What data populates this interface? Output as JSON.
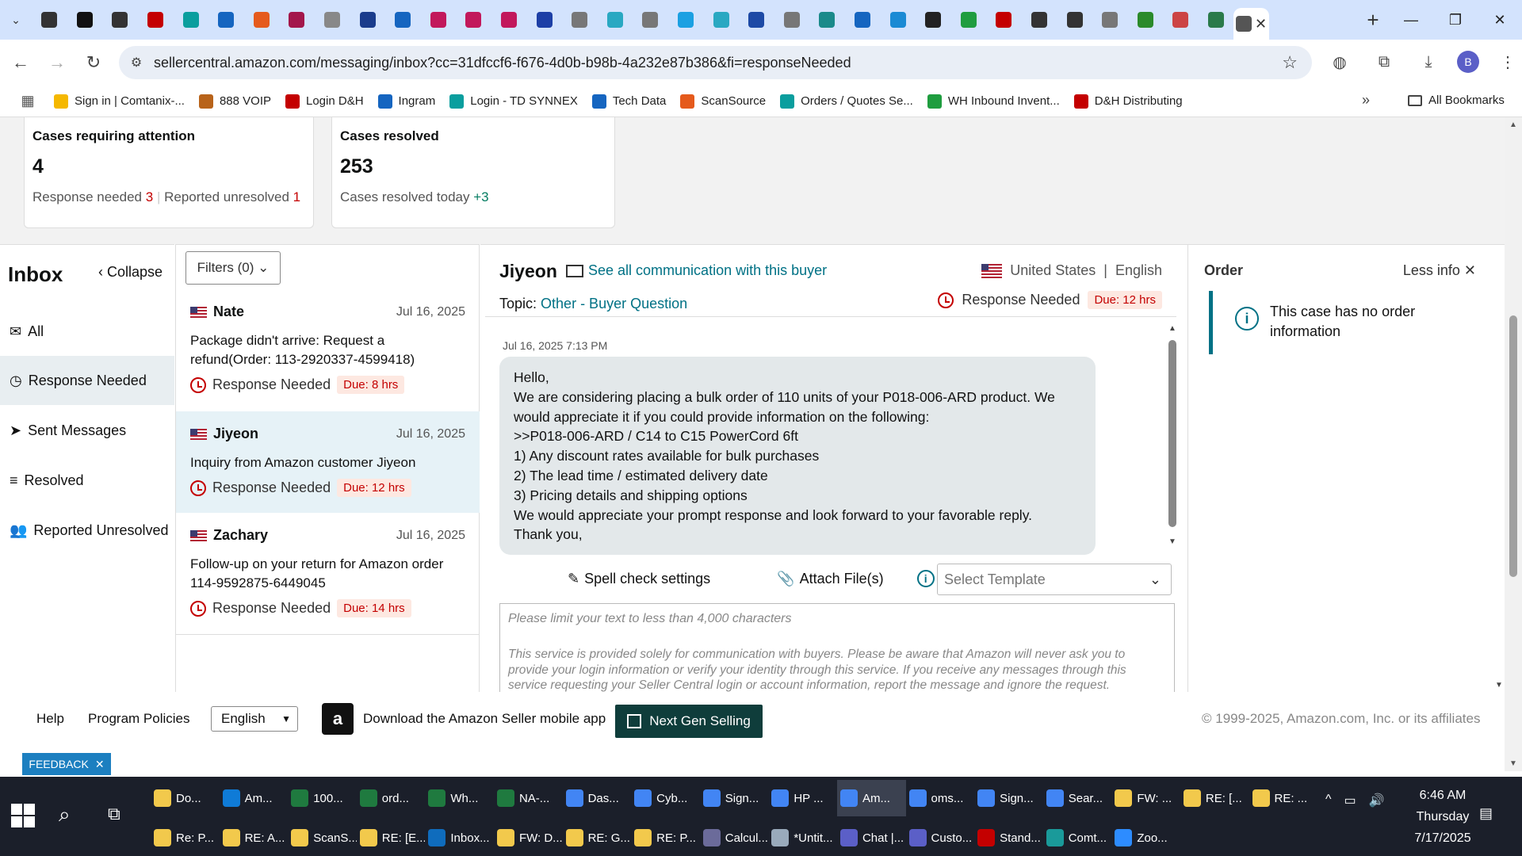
{
  "browser": {
    "tabs": [
      {
        "color": "#333"
      },
      {
        "color": "#111"
      },
      {
        "color": "#333"
      },
      {
        "color": "#c40000"
      },
      {
        "color": "#0a9e9e"
      },
      {
        "color": "#1565c0"
      },
      {
        "color": "#e55a1c"
      },
      {
        "color": "#a3174b"
      },
      {
        "color": "#888"
      },
      {
        "color": "#1a3c8c"
      },
      {
        "color": "#1565c0"
      },
      {
        "color": "#c2185b"
      },
      {
        "color": "#c2185b"
      },
      {
        "color": "#c2185b"
      },
      {
        "color": "#1d3fa6"
      },
      {
        "color": "#777"
      },
      {
        "color": "#29a8c2"
      },
      {
        "color": "#777"
      },
      {
        "color": "#1ba0e2"
      },
      {
        "color": "#29a8c2"
      },
      {
        "color": "#1d4aa6"
      },
      {
        "color": "#777"
      },
      {
        "color": "#1a8a8a"
      },
      {
        "color": "#1565c0"
      },
      {
        "color": "#1a8ad4"
      },
      {
        "color": "#222"
      },
      {
        "color": "#1f9d3f"
      },
      {
        "color": "#c40000"
      },
      {
        "color": "#333"
      },
      {
        "color": "#333"
      },
      {
        "color": "#777"
      },
      {
        "color": "#2a8a2a"
      },
      {
        "color": "#cc4444"
      },
      {
        "color": "#2a7a4a"
      },
      {
        "color": "#555"
      }
    ],
    "close_tab": "✕",
    "new_tab": "+",
    "url": "sellercentral.amazon.com/messaging/inbox?cc=31dfccf6-f676-4d0b-b98b-4a232e87b386&fi=responseNeeded",
    "profile_initial": "B",
    "bookmarks": [
      {
        "label": "Sign in | Comtanix-...",
        "color": "#f5b800"
      },
      {
        "label": "888 VOIP",
        "color": "#b8631a"
      },
      {
        "label": "Login D&H",
        "color": "#c40000"
      },
      {
        "label": "Ingram",
        "color": "#1565c0"
      },
      {
        "label": "Login - TD SYNNEX",
        "color": "#0a9e9e"
      },
      {
        "label": "Tech Data",
        "color": "#1565c0"
      },
      {
        "label": "ScanSource",
        "color": "#e55a1c"
      },
      {
        "label": "Orders / Quotes Se...",
        "color": "#0a9e9e"
      },
      {
        "label": "WH Inbound Invent...",
        "color": "#1f9d3f"
      },
      {
        "label": "D&H Distributing",
        "color": "#c40000"
      }
    ],
    "bookmarks_more": "»",
    "all_bookmarks": "All Bookmarks"
  },
  "stats": {
    "attention": {
      "title": "Cases requiring attention",
      "count": "4",
      "label1": "Response needed",
      "val1": "3",
      "label2": "Reported unresolved",
      "val2": "1"
    },
    "resolved": {
      "title": "Cases resolved",
      "count": "253",
      "label1": "Cases resolved today",
      "val1": "+3"
    }
  },
  "nav": {
    "title": "Inbox",
    "collapse": "Collapse",
    "items": [
      {
        "label": "All",
        "icon": "✉"
      },
      {
        "label": "Response Needed",
        "icon": "◷"
      },
      {
        "label": "Sent Messages",
        "icon": "➤"
      },
      {
        "label": "Resolved",
        "icon": "≡"
      },
      {
        "label": "Reported Unresolved",
        "icon": "👥"
      }
    ]
  },
  "list": {
    "filters": "Filters (0)",
    "conversations": [
      {
        "name": "Nate",
        "date": "Jul 16, 2025",
        "subject": "Package didn't arrive: Request a refund(Order: 113-2920337-4599418)",
        "status": "Response Needed",
        "due": "Due: 8 hrs"
      },
      {
        "name": "Jiyeon",
        "date": "Jul 16, 2025",
        "subject": "Inquiry from Amazon customer Jiyeon",
        "status": "Response Needed",
        "due": "Due: 12 hrs"
      },
      {
        "name": "Zachary",
        "date": "Jul 16, 2025",
        "subject": "Follow-up on your return for Amazon order 114-9592875-6449045",
        "status": "Response Needed",
        "due": "Due: 14 hrs"
      }
    ]
  },
  "thread": {
    "buyer": "Jiyeon",
    "see_all": "See all communication with this buyer",
    "country": "United States",
    "language": "English",
    "topic_label": "Topic:",
    "topic_value": "Other - Buyer Question",
    "status": "Response Needed",
    "due": "Due: 12 hrs",
    "message_date": "Jul 16, 2025 7:13 PM",
    "message_lines": [
      "Hello,",
      "We are considering placing a bulk order of 110 units of your P018-006-ARD product. We would appreciate it if you could provide information on the following:",
      ">>P018-006-ARD  / C14 to C15 PowerCord 6ft",
      "1) Any discount rates available for bulk purchases",
      "2) The lead time / estimated delivery date",
      "3) Pricing details and shipping options",
      "We would appreciate your prompt response and look forward to your favorable reply.",
      "Thank you,"
    ],
    "spell_check": "Spell check settings",
    "attach": "Attach File(s)",
    "template_placeholder": "Select Template",
    "compose_placeholder": "Please limit your text to less than 4,000 characters",
    "disclaimer": "This service is provided solely for communication with buyers. Please be aware that Amazon will never ask you to provide your login information or verify your identity through this service. If you receive any messages through this service requesting your Seller Central login or account information, report the message and ignore the request."
  },
  "order": {
    "title": "Order",
    "less_info": "Less info",
    "message": "This case has no order information"
  },
  "footer": {
    "help": "Help",
    "policies": "Program Policies",
    "language": "English",
    "app": "Download the Amazon Seller mobile app",
    "next_gen": "Next Gen Selling",
    "copyright": "© 1999-2025, Amazon.com, Inc. or its affiliates",
    "feedback": "FEEDBACK"
  },
  "taskbar": {
    "row1": [
      {
        "label": "Do...",
        "color": "#f2c94c"
      },
      {
        "label": "Am...",
        "color": "#0f7bd7"
      },
      {
        "label": "100...",
        "color": "#1f7a3f"
      },
      {
        "label": "ord...",
        "color": "#1f7a3f"
      },
      {
        "label": "Wh...",
        "color": "#1f7a3f"
      },
      {
        "label": "NA-...",
        "color": "#1f7a3f"
      },
      {
        "label": "Das...",
        "color": "#4285f4"
      },
      {
        "label": "Cyb...",
        "color": "#4285f4"
      },
      {
        "label": "Sign...",
        "color": "#4285f4"
      },
      {
        "label": "HP ...",
        "color": "#4285f4"
      },
      {
        "label": "Am...",
        "color": "#4285f4",
        "active": true
      },
      {
        "label": "oms...",
        "color": "#4285f4"
      },
      {
        "label": "Sign...",
        "color": "#4285f4"
      },
      {
        "label": "Sear...",
        "color": "#4285f4"
      },
      {
        "label": "FW: ...",
        "color": "#f2c94c"
      },
      {
        "label": "RE: [...",
        "color": "#f2c94c"
      },
      {
        "label": "RE: ...",
        "color": "#f2c94c"
      }
    ],
    "row2": [
      {
        "label": "Re: P...",
        "color": "#f2c94c"
      },
      {
        "label": "RE: A...",
        "color": "#f2c94c"
      },
      {
        "label": "ScanS...",
        "color": "#f2c94c"
      },
      {
        "label": "RE: [E...",
        "color": "#f2c94c"
      },
      {
        "label": "Inbox...",
        "color": "#0f6cbd"
      },
      {
        "label": "FW: D...",
        "color": "#f2c94c"
      },
      {
        "label": "RE: G...",
        "color": "#f2c94c"
      },
      {
        "label": "RE: P...",
        "color": "#f2c94c"
      },
      {
        "label": "Calcul...",
        "color": "#6b6b9a"
      },
      {
        "label": "*Untit...",
        "color": "#9ab"
      },
      {
        "label": "Chat |...",
        "color": "#5b5fc7"
      },
      {
        "label": "Custo...",
        "color": "#5b5fc7"
      },
      {
        "label": "Stand...",
        "color": "#c40000"
      },
      {
        "label": "Comt...",
        "color": "#1a9a9a"
      },
      {
        "label": "Zoo...",
        "color": "#2d8cff"
      }
    ],
    "time": "6:46 AM",
    "day": "Thursday",
    "date": "7/17/2025"
  }
}
